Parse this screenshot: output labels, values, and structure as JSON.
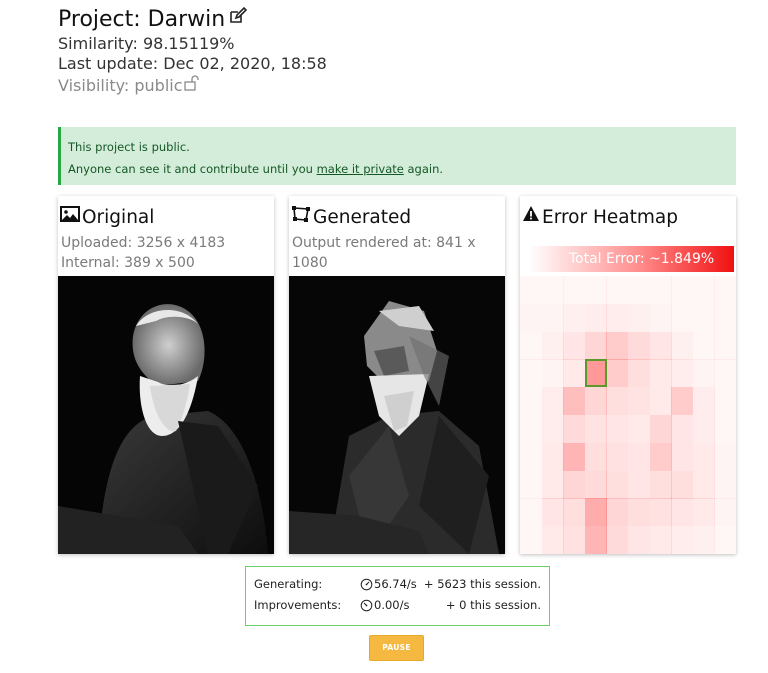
{
  "project": {
    "title": "Project: Darwin",
    "similarity": "Similarity: 98.15119%",
    "last_update": "Last update: Dec 02, 2020, 18:58",
    "visibility": "Visibility: public"
  },
  "alert": {
    "line1": "This project is public.",
    "line2_prefix": "Anyone can see it and contribute until you ",
    "line2_link": "make it private",
    "line2_suffix": " again."
  },
  "cards": {
    "original": {
      "title": "Original",
      "line1": "Uploaded: 3256 x 4183",
      "line2": "Internal: 389 x 500"
    },
    "generated": {
      "title": "Generated",
      "line1": "Output rendered at: 841 x",
      "line2": "1080"
    },
    "heatmap": {
      "title": "Error Heatmap",
      "total_error": "Total Error: ~1.849%"
    }
  },
  "stats": {
    "generating_label": "Generating:",
    "generating_rate": "56.74/s",
    "generating_session": "+ 5623 this session.",
    "improvements_label": "Improvements:",
    "improvements_rate": "0.00/s",
    "improvements_session": "+ 0 this session."
  },
  "pause_label": "PAUSE",
  "colors": {
    "alert_bg": "#d4edda",
    "alert_border": "#28a745",
    "heat": "#ff5a5a",
    "highlight": "#5a9a2a",
    "pause": "#f5b942"
  },
  "heatmap_levels": [
    [
      0.05,
      0.05,
      0.05,
      0.05,
      0.05,
      0.05,
      0.05,
      0.05,
      0.05,
      0.05
    ],
    [
      0.06,
      0.06,
      0.08,
      0.1,
      0.1,
      0.08,
      0.06,
      0.05,
      0.05,
      0.05
    ],
    [
      0.05,
      0.08,
      0.14,
      0.22,
      0.28,
      0.2,
      0.14,
      0.08,
      0.05,
      0.05
    ],
    [
      0.05,
      0.06,
      0.12,
      0.55,
      0.28,
      0.18,
      0.12,
      0.1,
      0.06,
      0.05
    ],
    [
      0.05,
      0.1,
      0.35,
      0.22,
      0.18,
      0.15,
      0.12,
      0.28,
      0.1,
      0.05
    ],
    [
      0.05,
      0.1,
      0.2,
      0.15,
      0.14,
      0.12,
      0.22,
      0.14,
      0.1,
      0.05
    ],
    [
      0.05,
      0.12,
      0.4,
      0.18,
      0.16,
      0.14,
      0.28,
      0.14,
      0.12,
      0.06
    ],
    [
      0.05,
      0.12,
      0.22,
      0.2,
      0.18,
      0.14,
      0.18,
      0.18,
      0.12,
      0.06
    ],
    [
      0.05,
      0.14,
      0.18,
      0.45,
      0.22,
      0.18,
      0.16,
      0.14,
      0.12,
      0.06
    ],
    [
      0.05,
      0.12,
      0.16,
      0.4,
      0.2,
      0.14,
      0.12,
      0.1,
      0.08,
      0.05
    ]
  ]
}
